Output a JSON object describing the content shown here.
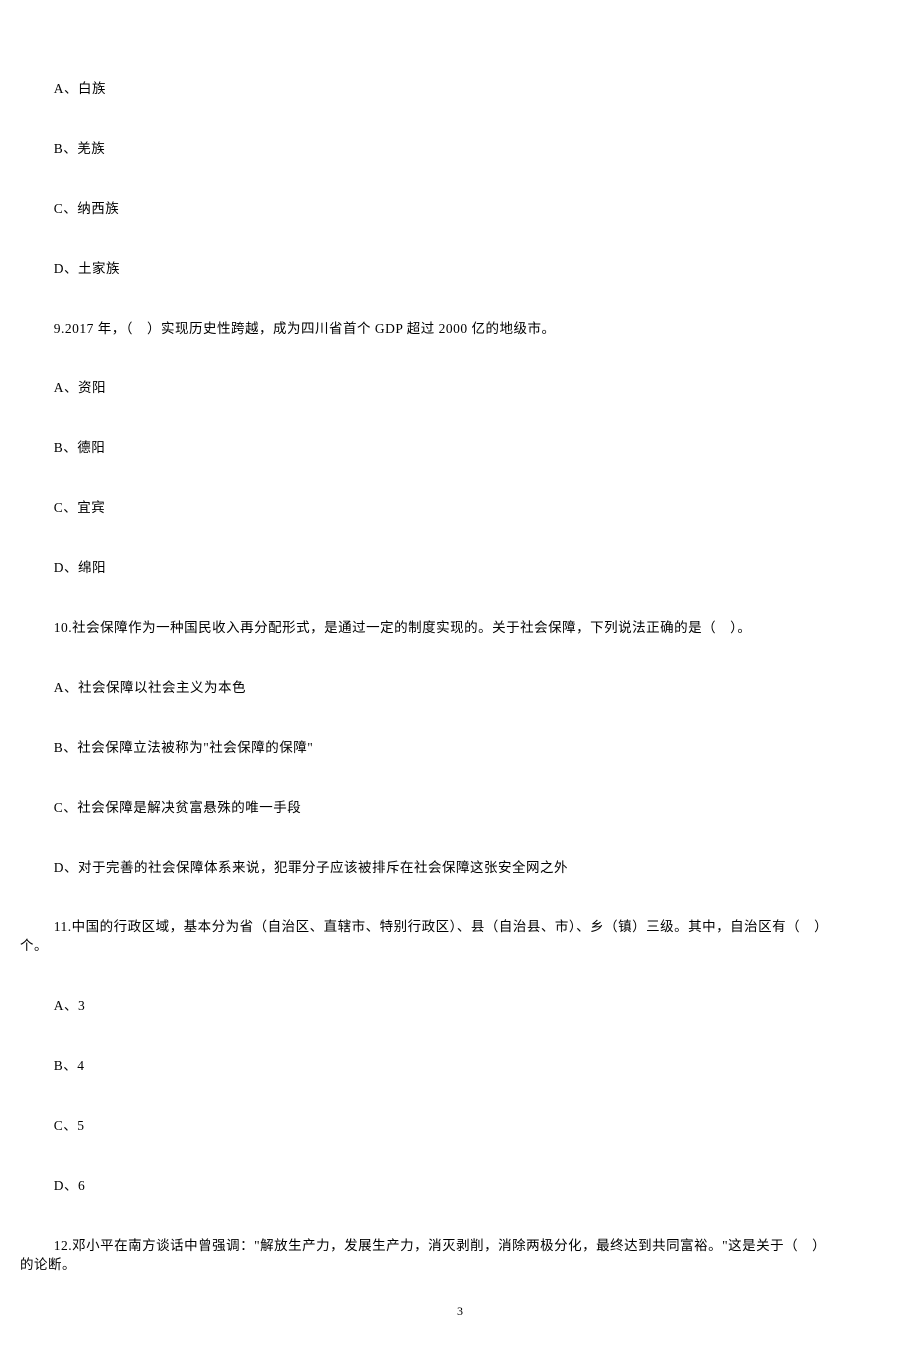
{
  "prev_options": {
    "A": "A、白族",
    "B": "B、羌族",
    "C": "C、纳西族",
    "D": "D、土家族"
  },
  "q9": {
    "stem": "9.2017 年，（　）实现历史性跨越，成为四川省首个 GDP 超过 2000 亿的地级市。",
    "A": "A、资阳",
    "B": "B、德阳",
    "C": "C、宜宾",
    "D": "D、绵阳"
  },
  "q10": {
    "stem": "10.社会保障作为一种国民收入再分配形式，是通过一定的制度实现的。关于社会保障，下列说法正确的是（　）。",
    "A": "A、社会保障以社会主义为本色",
    "B": "B、社会保障立法被称为\"社会保障的保障\"",
    "C": "C、社会保障是解决贫富悬殊的唯一手段",
    "D": "D、对于完善的社会保障体系来说，犯罪分子应该被排斥在社会保障这张安全网之外"
  },
  "q11": {
    "line1": "11.中国的行政区域，基本分为省（自治区、直辖市、特别行政区）、县（自治县、市）、乡（镇）三级。其中，自治区有（　）",
    "line2": "个。",
    "A": "A、3",
    "B": "B、4",
    "C": "C、5",
    "D": "D、6"
  },
  "q12": {
    "line1": "12.邓小平在南方谈话中曾强调：\"解放生产力，发展生产力，消灭剥削，消除两极分化，最终达到共同富裕。\"这是关于（　）",
    "line2": "的论断。"
  },
  "page_number": "3"
}
